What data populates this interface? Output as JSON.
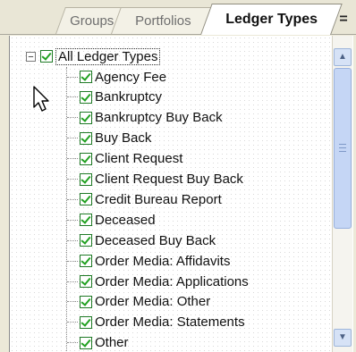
{
  "tabs": {
    "groups": "Groups",
    "portfolios": "Portfolios",
    "ledger_types": "Ledger Types",
    "menu_glyph": "="
  },
  "tree": {
    "root": {
      "label": "All Ledger Types",
      "expander": "−",
      "checked": true
    },
    "items": [
      "Agency Fee",
      "Bankruptcy",
      "Bankruptcy Buy Back",
      "Buy Back",
      "Client Request",
      "Client Request Buy Back",
      "Credit Bureau Report",
      "Deceased",
      "Deceased Buy Back",
      "Order Media: Affidavits",
      "Order Media: Applications",
      "Order Media: Other",
      "Order Media: Statements",
      "Other"
    ]
  },
  "scrollbar": {
    "up_arrow": "▲",
    "down_arrow": "▼"
  },
  "icons": {
    "cursor": "arrow-cursor-icon",
    "checkbox": "checkmark-icon"
  },
  "colors": {
    "check_green": "#21a121",
    "scroll_blue": "#c5d6f5"
  }
}
